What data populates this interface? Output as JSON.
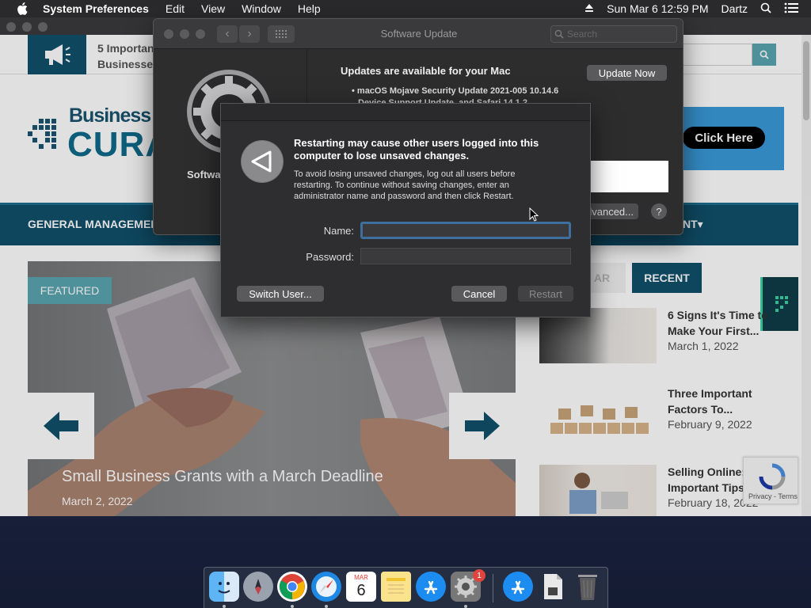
{
  "menubar": {
    "app_name": "System Preferences",
    "menus": [
      "Edit",
      "View",
      "Window",
      "Help"
    ],
    "clock": "Sun Mar 6  12:59 PM",
    "user": "Dartz"
  },
  "website": {
    "header_title": "5 Important Businesses",
    "brand_top": "Business Ma",
    "brand_bottom": "CURAT",
    "ad_button": "Click Here",
    "nav_left": "GENERAL MANAGEMENT",
    "nav_right": "NT",
    "featured_tag": "FEATURED",
    "featured_title": "Small Business Grants with a March Deadline",
    "featured_date": "March 2, 2022",
    "tab_popular": "AR",
    "tab_recent": "RECENT",
    "posts": [
      {
        "title": "6 Signs It's Time to Make Your First...",
        "date": "March 1, 2022"
      },
      {
        "title": "Three Important Factors To...",
        "date": "February 9, 2022"
      },
      {
        "title": "Selling Online: Important Tips",
        "date": "February 18, 2022"
      }
    ],
    "recaptcha": "Privacy - Terms"
  },
  "software_update": {
    "title": "Software Update",
    "search_placeholder": "Search",
    "sidebar_label": "Software Update",
    "updates_title": "Updates are available for your Mac",
    "update_now": "Update Now",
    "item1": "• macOS Mojave Security Update 2021-005 10.14.6",
    "item2": "Device Support Update, and Safari 14.1.2",
    "advanced": "Advanced...",
    "help": "?"
  },
  "auth_sheet": {
    "heading": "Restarting may cause other users logged into this computer to lose unsaved changes.",
    "body": "To avoid losing unsaved changes, log out all users before restarting. To continue without saving changes, enter an administrator name and password and then click Restart.",
    "name_label": "Name:",
    "password_label": "Password:",
    "name_value": "",
    "password_value": "",
    "switch_user": "Switch User...",
    "cancel": "Cancel",
    "restart": "Restart"
  },
  "dock": {
    "calendar_month": "MAR",
    "calendar_day": "6",
    "prefs_badge": "1",
    "items": [
      "finder-icon",
      "launchpad-icon",
      "chrome-icon",
      "safari-icon",
      "calendar-icon",
      "notes-icon",
      "app-store-icon",
      "system-preferences-icon",
      "app-store-download-icon",
      "file-icon",
      "trash-icon"
    ]
  }
}
